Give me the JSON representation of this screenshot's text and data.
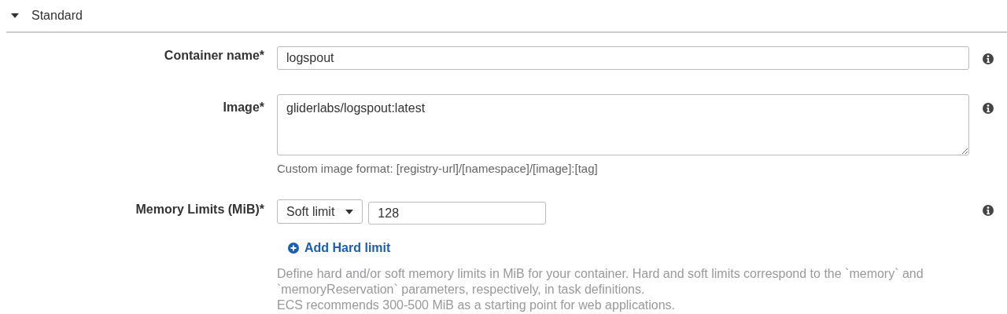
{
  "section": {
    "title": "Standard",
    "expanded": true
  },
  "fields": [
    {
      "kind": "input",
      "label": "Container name*",
      "value": "logspout"
    },
    {
      "kind": "textarea",
      "label": "Image*",
      "value": "gliderlabs/logspout:latest",
      "hint": "Custom image format: [registry-url]/[namespace]/[image]:[tag]"
    },
    {
      "kind": "memory",
      "label": "Memory Limits (MiB)*",
      "select": "Soft limit",
      "value": "128",
      "link": "Add Hard limit",
      "help": [
        "Define hard and/or soft memory limits in MiB for your container. Hard and soft limits correspond to the `memory` and `memoryReservation` parameters, respectively, in task definitions.",
        "ECS recommends 300-500 MiB as a starting point for web applications."
      ]
    }
  ]
}
